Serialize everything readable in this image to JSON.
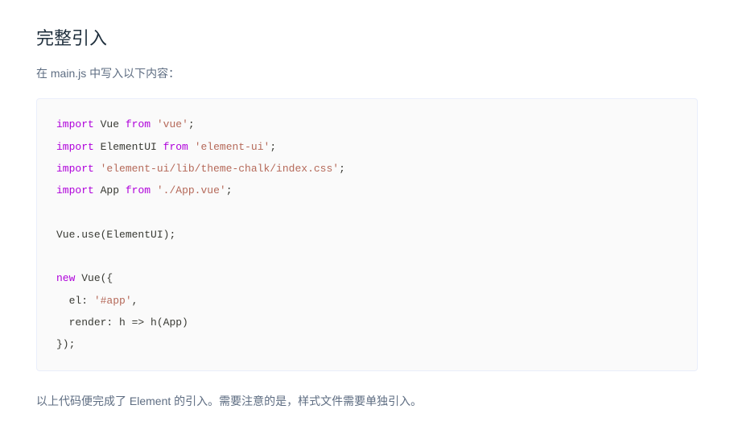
{
  "heading": "完整引入",
  "description": "在 main.js 中写入以下内容：",
  "code": {
    "tokens": [
      {
        "cls": "kw",
        "t": "import"
      },
      {
        "cls": "punct",
        "t": " "
      },
      {
        "cls": "var",
        "t": "Vue"
      },
      {
        "cls": "punct",
        "t": " "
      },
      {
        "cls": "kw",
        "t": "from"
      },
      {
        "cls": "punct",
        "t": " "
      },
      {
        "cls": "str",
        "t": "'vue'"
      },
      {
        "cls": "punct",
        "t": ";\n"
      },
      {
        "cls": "kw",
        "t": "import"
      },
      {
        "cls": "punct",
        "t": " "
      },
      {
        "cls": "var",
        "t": "ElementUI"
      },
      {
        "cls": "punct",
        "t": " "
      },
      {
        "cls": "kw",
        "t": "from"
      },
      {
        "cls": "punct",
        "t": " "
      },
      {
        "cls": "str",
        "t": "'element-ui'"
      },
      {
        "cls": "punct",
        "t": ";\n"
      },
      {
        "cls": "kw",
        "t": "import"
      },
      {
        "cls": "punct",
        "t": " "
      },
      {
        "cls": "str",
        "t": "'element-ui/lib/theme-chalk/index.css'"
      },
      {
        "cls": "punct",
        "t": ";\n"
      },
      {
        "cls": "kw",
        "t": "import"
      },
      {
        "cls": "punct",
        "t": " "
      },
      {
        "cls": "var",
        "t": "App"
      },
      {
        "cls": "punct",
        "t": " "
      },
      {
        "cls": "kw",
        "t": "from"
      },
      {
        "cls": "punct",
        "t": " "
      },
      {
        "cls": "str",
        "t": "'./App.vue'"
      },
      {
        "cls": "punct",
        "t": ";\n\n"
      },
      {
        "cls": "var",
        "t": "Vue"
      },
      {
        "cls": "punct",
        "t": "."
      },
      {
        "cls": "fn",
        "t": "use"
      },
      {
        "cls": "punct",
        "t": "(ElementUI);\n\n"
      },
      {
        "cls": "kw",
        "t": "new"
      },
      {
        "cls": "punct",
        "t": " "
      },
      {
        "cls": "var",
        "t": "Vue"
      },
      {
        "cls": "punct",
        "t": "({\n"
      },
      {
        "cls": "punct",
        "t": "  "
      },
      {
        "cls": "attr",
        "t": "el"
      },
      {
        "cls": "punct",
        "t": ": "
      },
      {
        "cls": "str",
        "t": "'#app'"
      },
      {
        "cls": "punct",
        "t": ",\n"
      },
      {
        "cls": "punct",
        "t": "  "
      },
      {
        "cls": "attr",
        "t": "render"
      },
      {
        "cls": "punct",
        "t": ": h => "
      },
      {
        "cls": "fn",
        "t": "h"
      },
      {
        "cls": "punct",
        "t": "(App)\n"
      },
      {
        "cls": "punct",
        "t": "});"
      }
    ]
  },
  "footer": "以上代码便完成了 Element 的引入。需要注意的是，样式文件需要单独引入。"
}
